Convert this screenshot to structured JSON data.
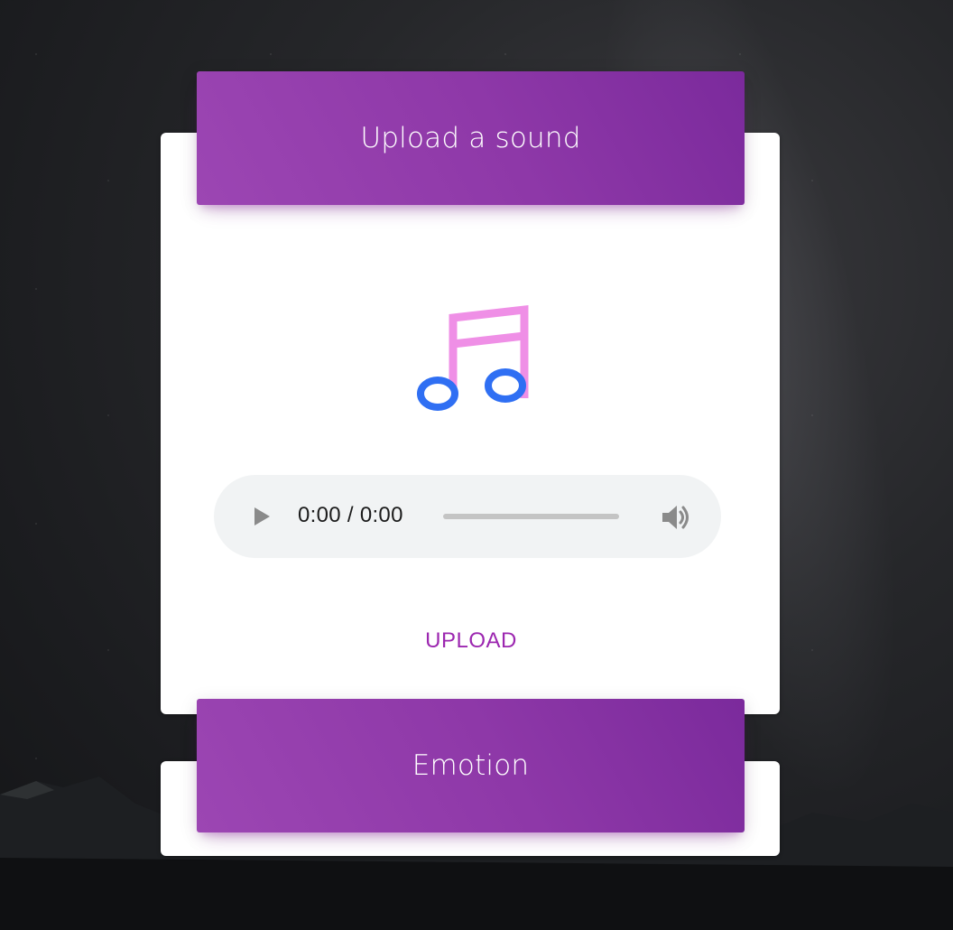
{
  "upload_card": {
    "title": "Upload a sound",
    "icon": "music-note-icon",
    "audio_player": {
      "time": "0:00 / 0:00",
      "play_icon": "play-icon",
      "volume_icon": "volume-icon"
    },
    "upload_label": "UPLOAD"
  },
  "emotion_card": {
    "title": "Emotion"
  },
  "colors": {
    "header_gradient_start": "#9c46b3",
    "header_gradient_end": "#7b2a9c",
    "accent": "#9c27b0",
    "note_stem": "#ef8fe6",
    "note_heads": "#2f6ff3",
    "player_bg": "#f1f3f4"
  }
}
